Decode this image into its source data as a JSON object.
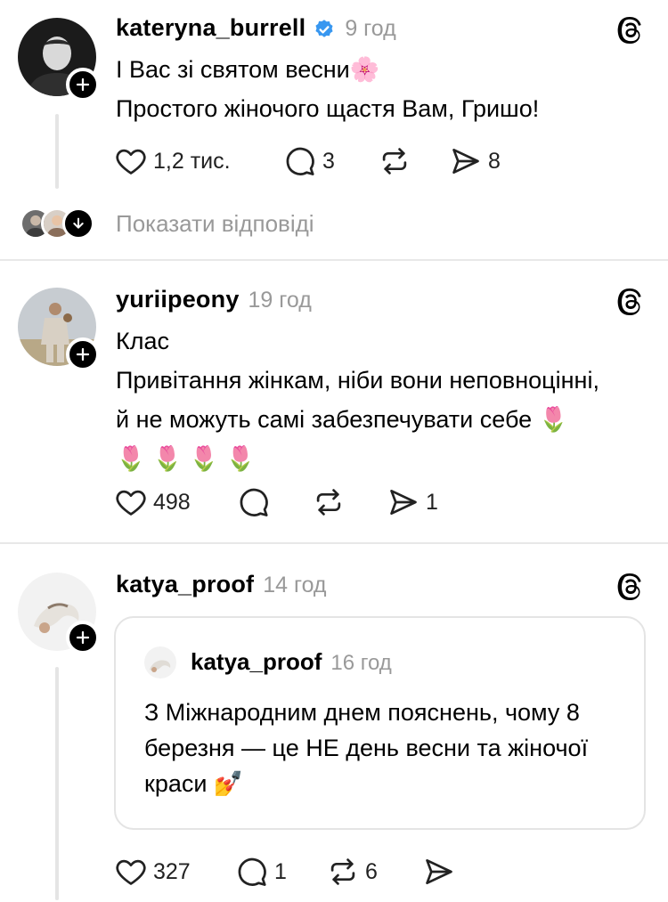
{
  "posts": [
    {
      "username": "kateryna_burrell",
      "verified": true,
      "time": "9 год",
      "lines": [
        "І Вас зі святом весни🌸",
        "Простого жіночого щастя Вам, Гришо!"
      ],
      "likes": "1,2 тис.",
      "replies": "3",
      "reposts": "",
      "shares": "8",
      "show_replies": "Показати відповіді"
    },
    {
      "username": "yuriipeony",
      "time": "19 год",
      "lines": [
        "Клас",
        "Привітання жінкам, ніби вони неповноцінні,",
        "й не можуть самі забезпечувати себе 🌷",
        "🌷 🌷 🌷 🌷"
      ],
      "likes": "498",
      "replies": "",
      "reposts": "",
      "shares": "1"
    },
    {
      "username": "katya_proof",
      "time": "14 год",
      "quote": {
        "username": "katya_proof",
        "time": "16 год",
        "lines": [
          "З Міжнародним днем пояснень, чому 8",
          "березня — це НЕ день весни та жіночої",
          "краси 💅"
        ]
      },
      "likes": "327",
      "replies": "1",
      "reposts": "6",
      "shares": ""
    }
  ],
  "icons": {
    "like": "heart-icon",
    "reply": "comment-icon",
    "repost": "repost-icon",
    "share": "send-icon",
    "threads": "threads-logo-icon",
    "follow": "plus-icon"
  },
  "colors": {
    "verified": "#3897f0",
    "muted": "#999999"
  }
}
